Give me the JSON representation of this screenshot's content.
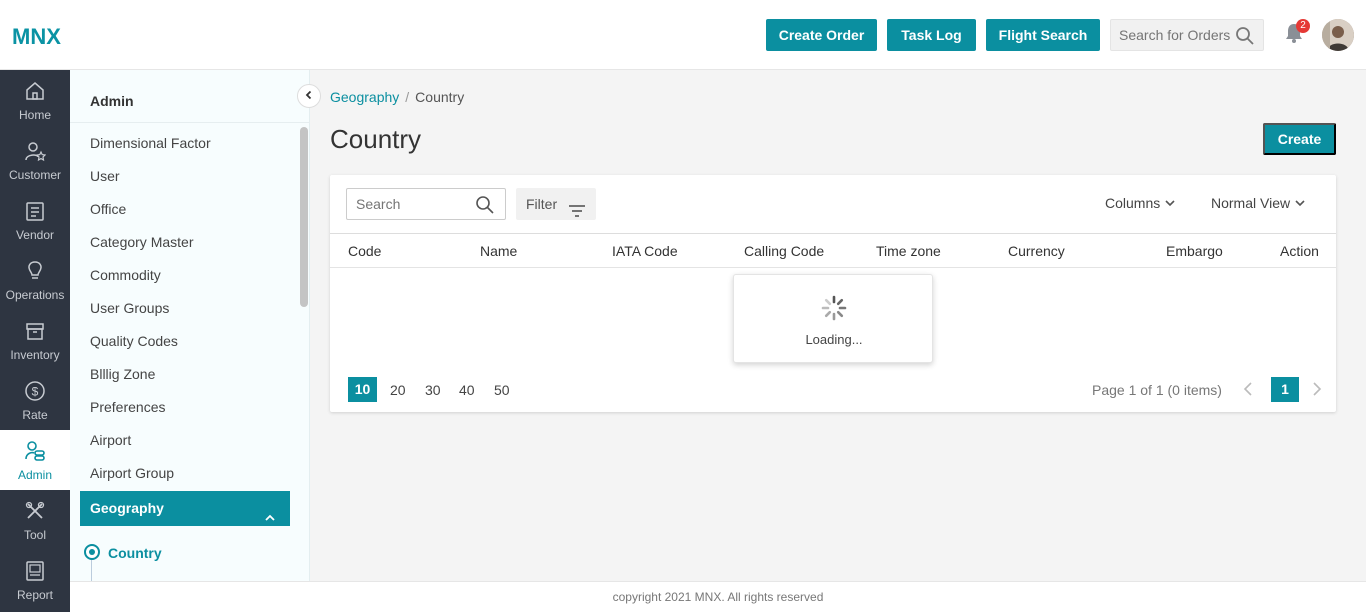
{
  "header": {
    "logo": "MNX",
    "buttons": [
      "Create Order",
      "Task Log",
      "Flight Search"
    ],
    "search_placeholder": "Search for Orders",
    "notification_count": "2",
    "accent_color": "#0b8fa0"
  },
  "leftnav": {
    "items": [
      {
        "label": "Home",
        "icon": "home-icon"
      },
      {
        "label": "Customer",
        "icon": "customer-icon"
      },
      {
        "label": "Vendor",
        "icon": "vendor-icon"
      },
      {
        "label": "Operations",
        "icon": "operations-icon"
      },
      {
        "label": "Inventory",
        "icon": "inventory-icon"
      },
      {
        "label": "Rate",
        "icon": "dollar-icon"
      },
      {
        "label": "Admin",
        "icon": "admin-icon"
      },
      {
        "label": "Tool",
        "icon": "tool-icon"
      },
      {
        "label": "Report",
        "icon": "report-icon"
      }
    ],
    "active": "Admin"
  },
  "subnav": {
    "heading": "Admin",
    "items": [
      "Dimensional Factor",
      "User",
      "Office",
      "Category Master",
      "Commodity",
      "User Groups",
      "Quality Codes",
      "Blllig Zone",
      "Preferences",
      "Airport",
      "Airport Group"
    ],
    "expanded_group": "Geography",
    "selected_child": "Country"
  },
  "main": {
    "breadcrumb": {
      "parent": "Geography",
      "separator": "/",
      "current": "Country"
    },
    "title": "Country",
    "create_label": "Create",
    "toolbar": {
      "search_placeholder": "Search",
      "filter_label": "Filter",
      "columns_label": "Columns",
      "view_label": "Normal View"
    },
    "table": {
      "columns": [
        "Code",
        "Name",
        "IATA Code",
        "Calling Code",
        "Time zone",
        "Currency",
        "Embargo",
        "Action"
      ],
      "rows": []
    },
    "loading_text": "Loading...",
    "pagination": {
      "page_sizes": [
        "10",
        "20",
        "30",
        "40",
        "50"
      ],
      "selected_size": "10",
      "info": "Page 1 of 1 (0 items)",
      "current_page": "1"
    }
  },
  "footer": {
    "text": "copyright 2021 MNX. All rights reserved"
  }
}
